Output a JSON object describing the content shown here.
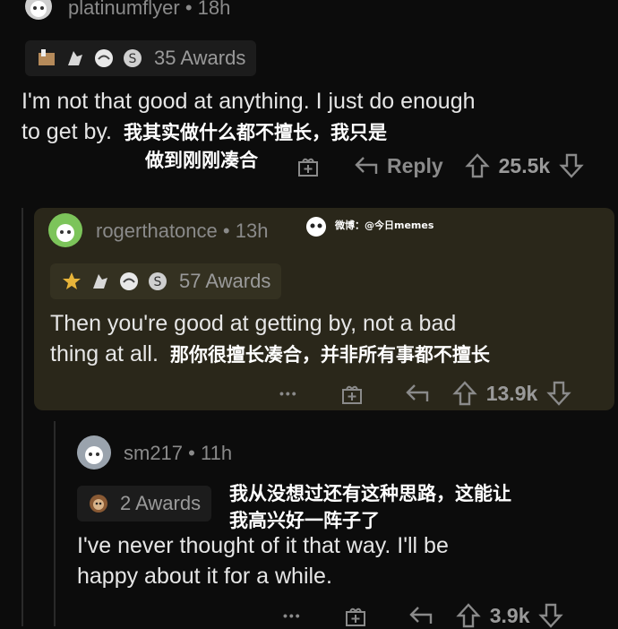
{
  "colors": {
    "bg": "#0c0c0c",
    "highlight": "#2a271a",
    "muted": "#8a8a8a",
    "text": "#e6e6e6"
  },
  "comment1": {
    "username": "platinumflyer",
    "age": "18h",
    "sep": "•",
    "award_count": "35 Awards",
    "text_en_line1": "I'm not that good at anything. I just do enough",
    "text_en_line2": "to get by.",
    "text_zh_line1": "我其实做什么都不擅长，我只是",
    "text_zh_line2": "做到刚刚凑合",
    "reply_label": "Reply",
    "votes": "25.5k",
    "icons": [
      "award-add-icon",
      "reply-arrow-icon",
      "upvote-icon",
      "downvote-icon"
    ]
  },
  "comment2": {
    "username": "rogerthatonce",
    "age": "13h",
    "sep": "•",
    "watermark": "微博：@今日memes",
    "award_count": "57 Awards",
    "text_en_line1": "Then you're good at getting by, not a bad",
    "text_en_line2": "thing at all.",
    "text_zh": "那你很擅长凑合，并非所有事都不擅长",
    "more": "•••",
    "votes": "13.9k"
  },
  "comment3": {
    "username": "sm217",
    "age": "11h",
    "sep": "•",
    "award_count": "2 Awards",
    "text_zh_line1": "我从没想过还有这种思路，这能让",
    "text_zh_line2": "我高兴好一阵子了",
    "text_en_line1": "I've never thought of it that way. I'll be",
    "text_en_line2": "happy about it for a while.",
    "more": "•••",
    "votes": "3.9k"
  }
}
